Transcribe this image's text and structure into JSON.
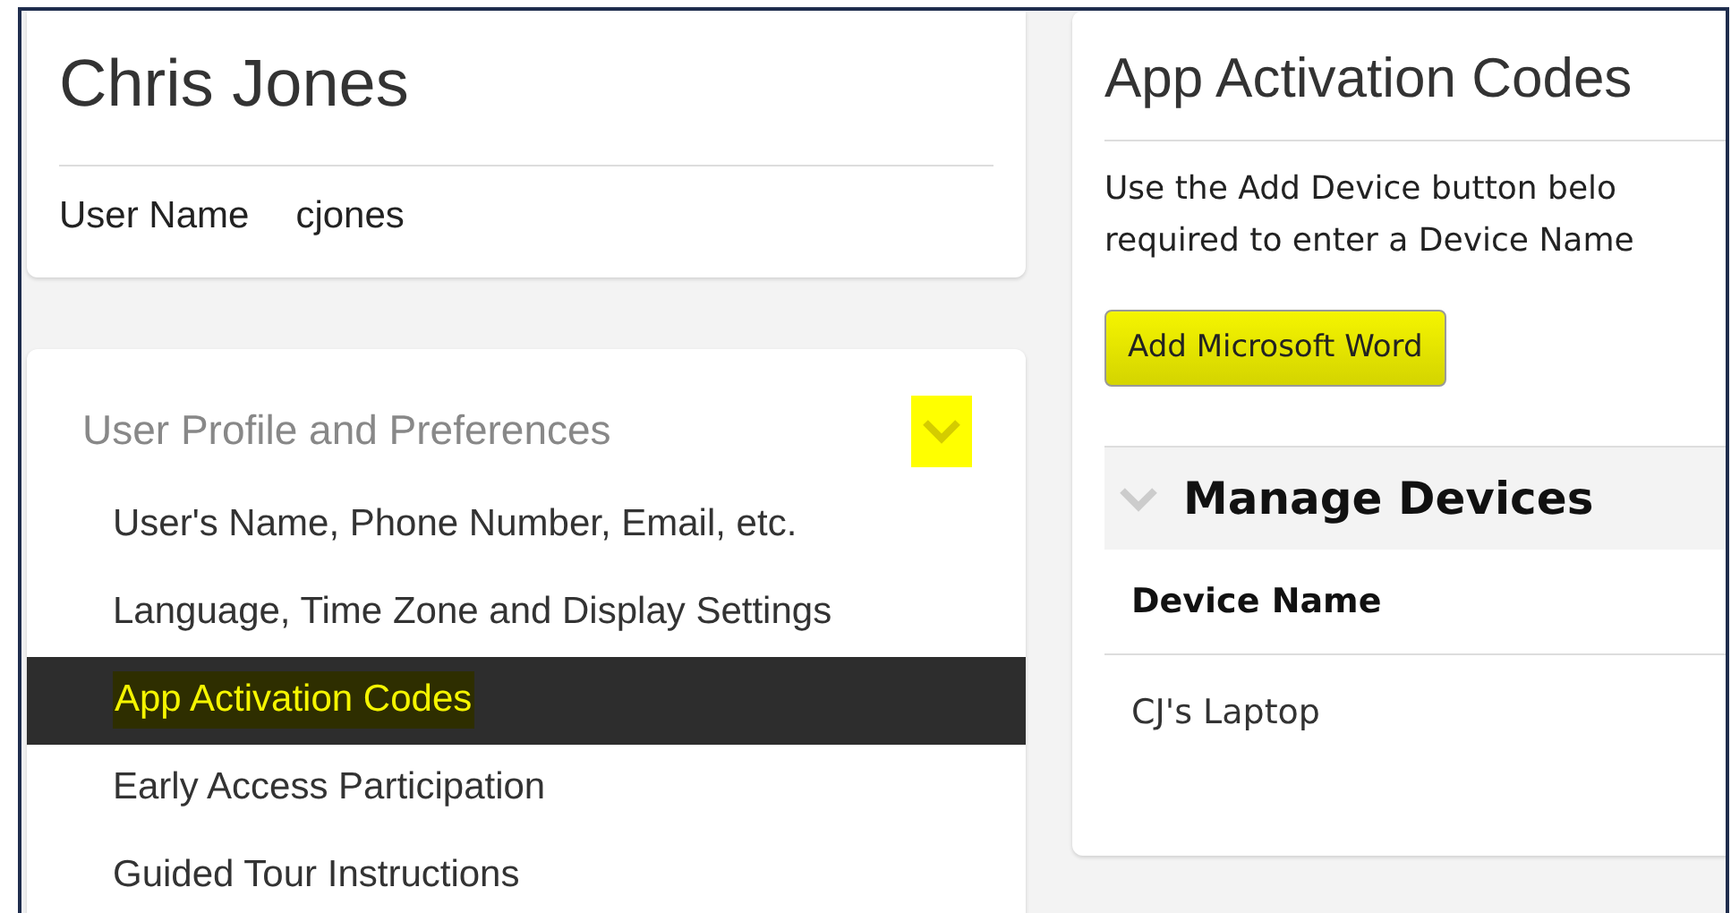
{
  "profile": {
    "name": "Chris Jones",
    "field_label": "User Name",
    "field_value": "cjones"
  },
  "menu": {
    "title": "User Profile and Preferences",
    "expanded": true,
    "highlighted_toggle": true,
    "items": [
      {
        "label": "User's Name, Phone Number, Email, etc.",
        "selected": false
      },
      {
        "label": "Language, Time Zone and Display Settings",
        "selected": false
      },
      {
        "label": "App Activation Codes",
        "selected": true
      },
      {
        "label": "Early Access Participation",
        "selected": false
      },
      {
        "label": "Guided Tour Instructions",
        "selected": false
      }
    ]
  },
  "panel": {
    "title": "App Activation Codes",
    "description_lines": [
      "Use the Add Device button belo",
      "required to enter a Device Name"
    ],
    "add_button": "Add Microsoft Word",
    "devices": {
      "title": "Manage Devices",
      "expanded": true,
      "columns": [
        "Device Name"
      ],
      "rows": [
        [
          "CJ's Laptop"
        ]
      ]
    }
  }
}
